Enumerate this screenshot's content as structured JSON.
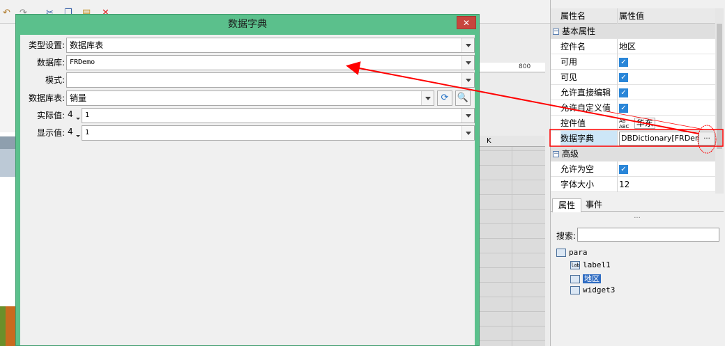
{
  "dialog": {
    "title": "数据字典",
    "close_glyph": "✕",
    "rows": [
      {
        "label": "类型设置:",
        "value": "数据库表"
      },
      {
        "label": "数据库:",
        "value": "FRDemo"
      },
      {
        "label": "模式:",
        "value": ""
      },
      {
        "label": "数据库表:",
        "value": "销量"
      },
      {
        "label": "实际值:",
        "spin": "4",
        "value": "1"
      },
      {
        "label": "显示值:",
        "spin": "4",
        "value": "1"
      }
    ]
  },
  "background": {
    "ruler_label": "800",
    "column_label": "K"
  },
  "properties": {
    "header_name": "属性名",
    "header_value": "属性值",
    "group_basic": "基本属性",
    "group_advanced": "高级",
    "rows": [
      {
        "name": "控件名",
        "value": "地区"
      },
      {
        "name": "可用",
        "checked": true
      },
      {
        "name": "可见",
        "checked": true
      },
      {
        "name": "允许直接编辑",
        "checked": true
      },
      {
        "name": "允许自定义值",
        "checked": true
      },
      {
        "name": "控件值",
        "value": "华东"
      },
      {
        "name": "数据字典",
        "value": "DBDictionary[FRDemo]"
      }
    ],
    "advanced_rows": [
      {
        "name": "允许为空",
        "checked": true
      },
      {
        "name": "字体大小",
        "value": "12"
      }
    ],
    "dict_button": "...",
    "tabs": [
      "属性",
      "事件"
    ],
    "splitter": "...",
    "search_label": "搜索:",
    "search_value": "",
    "tree": [
      {
        "label": "para",
        "icon": "form-icon"
      },
      {
        "label": "label1",
        "icon": "label-icon",
        "icon_text": "lab"
      },
      {
        "label": "地区",
        "icon": "combobox-icon",
        "selected": true
      },
      {
        "label": "widget3",
        "icon": "search-widget-icon"
      }
    ]
  },
  "colors": {
    "dialog_frame": "#5bc08c",
    "close_button": "#c7463d",
    "checkbox": "#2a86d8",
    "annotation": "#ff0000"
  }
}
